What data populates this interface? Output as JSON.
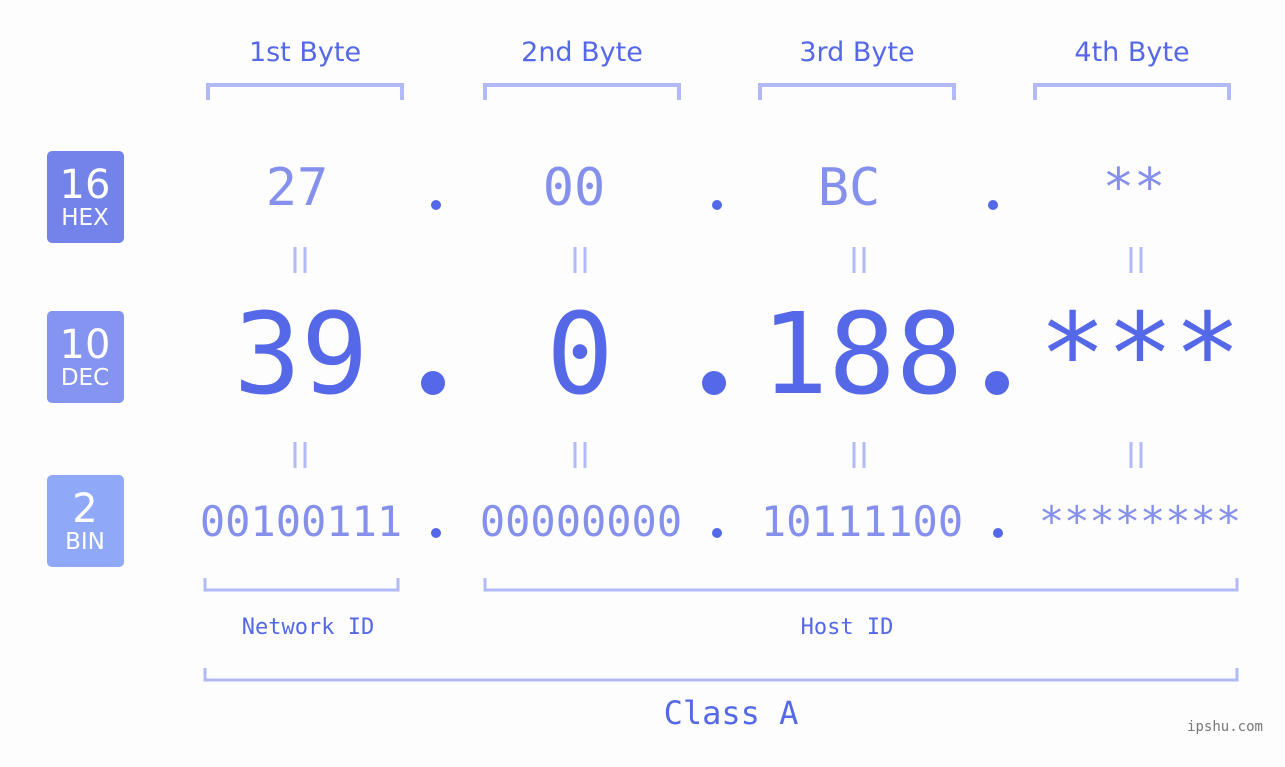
{
  "colors": {
    "background": "#fcfdfc",
    "accent": "#5468e8",
    "light_value": "#8490ec",
    "bracket": "#b1baf6",
    "badge_hex": "#7383ea",
    "badge_dec": "#8494f0",
    "badge_bin": "#90a8f8",
    "watermark": "#777777"
  },
  "byte_headers": [
    "1st Byte",
    "2nd Byte",
    "3rd Byte",
    "4th Byte"
  ],
  "badges": [
    {
      "number": "16",
      "label": "HEX"
    },
    {
      "number": "10",
      "label": "DEC"
    },
    {
      "number": "2",
      "label": "BIN"
    }
  ],
  "hex_values": [
    "27",
    "00",
    "BC",
    "**"
  ],
  "dec_values": [
    "39",
    "0",
    "188",
    "***"
  ],
  "bin_values": [
    "00100111",
    "00000000",
    "10111100",
    "********"
  ],
  "separator": ".",
  "equals": "=",
  "network_label": "Network ID",
  "host_label": "Host ID",
  "class_label": "Class A",
  "watermark": "ipshu.com"
}
